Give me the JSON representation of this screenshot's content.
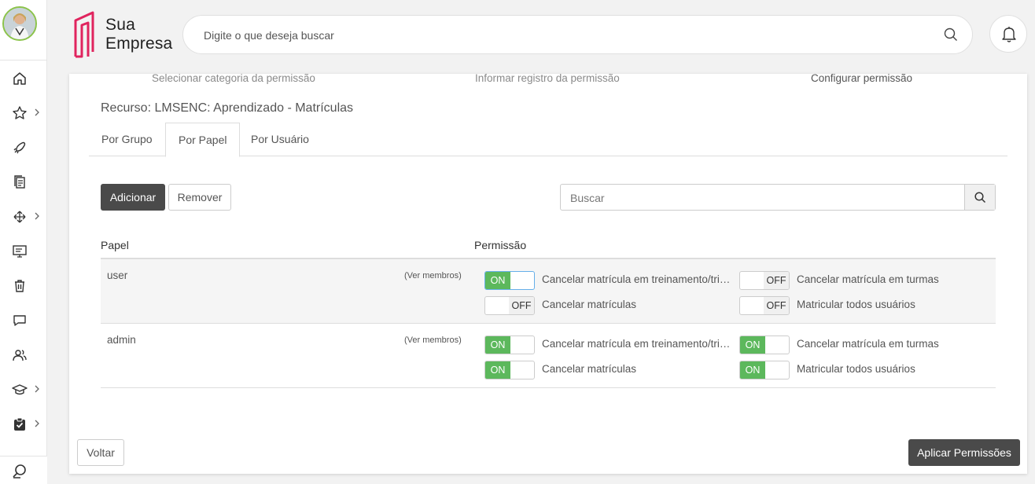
{
  "header": {
    "logo_line1": "Sua",
    "logo_line2": "Empresa",
    "search_placeholder": "Digite o que deseja buscar"
  },
  "colors": {
    "accent": "#e0245e",
    "toggle_on": "#5cb85c",
    "dark_button": "#4a4a4a",
    "avatar_ring": "#8bc34a"
  },
  "sidebar": {
    "items": [
      {
        "icon": "home-icon",
        "chevron": false
      },
      {
        "icon": "star-icon",
        "chevron": true
      },
      {
        "icon": "rocket-icon",
        "chevron": false
      },
      {
        "icon": "documents-icon",
        "chevron": false
      },
      {
        "icon": "arrows-icon",
        "chevron": true
      },
      {
        "icon": "monitor-icon",
        "chevron": false
      },
      {
        "icon": "trash-icon",
        "chevron": false
      },
      {
        "icon": "chat-icon",
        "chevron": false
      },
      {
        "icon": "users-icon",
        "chevron": false
      },
      {
        "icon": "graduation-cap-icon",
        "chevron": true
      },
      {
        "icon": "clipboard-check-icon",
        "chevron": true
      }
    ],
    "bottom_icon": "search-icon"
  },
  "steps": [
    "Selecionar categoria da permissão",
    "Informar registro da permissão",
    "Configurar permissão"
  ],
  "resource_label": "Recurso: LMSENC: Aprendizado - Matrículas",
  "tabs": [
    {
      "label": "Por Grupo",
      "active": false
    },
    {
      "label": "Por Papel",
      "active": true
    },
    {
      "label": "Por Usuário",
      "active": false
    }
  ],
  "actions": {
    "add": "Adicionar",
    "remove": "Remover",
    "search_placeholder": "Buscar"
  },
  "table": {
    "headers": [
      "Papel",
      "Permissão"
    ],
    "members_link": "(Ver membros)",
    "toggle_on_label": "ON",
    "toggle_off_label": "OFF",
    "rows": [
      {
        "role": "user",
        "permissions": [
          {
            "label": "Cancelar matrícula em treinamento/tri…",
            "state": "on"
          },
          {
            "label": "Cancelar matrícula em turmas",
            "state": "off"
          },
          {
            "label": "Cancelar matrículas",
            "state": "off"
          },
          {
            "label": "Matricular todos usuários",
            "state": "off"
          }
        ]
      },
      {
        "role": "admin",
        "permissions": [
          {
            "label": "Cancelar matrícula em treinamento/tri…",
            "state": "on"
          },
          {
            "label": "Cancelar matrícula em turmas",
            "state": "on"
          },
          {
            "label": "Cancelar matrículas",
            "state": "on"
          },
          {
            "label": "Matricular todos usuários",
            "state": "on"
          }
        ]
      }
    ]
  },
  "footer": {
    "back": "Voltar",
    "apply": "Aplicar Permissões"
  }
}
